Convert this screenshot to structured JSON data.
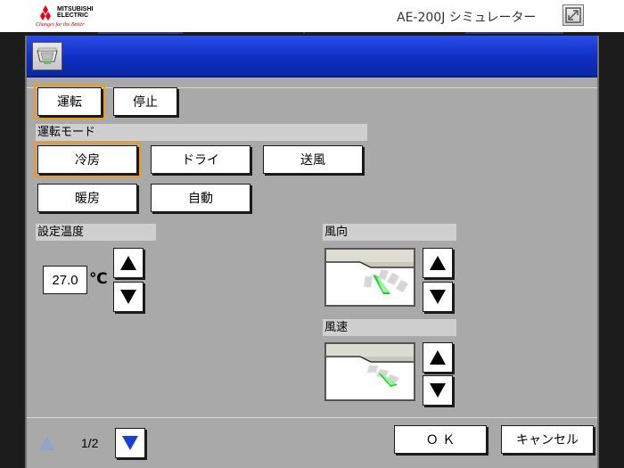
{
  "header": {
    "brand_name_line1": "MITSUBISHI",
    "brand_name_line2": "ELECTRIC",
    "tagline": "Changes for the Better",
    "app_title": "AE-200J シミュレーター",
    "brand_color": "#e60012"
  },
  "panel": {
    "title_bar_color": "#1434d6",
    "background": "#a9a9a9",
    "icons": {
      "unit": "ceiling-cassette-icon",
      "resize": "resize-icon"
    }
  },
  "power": {
    "on_label": "運転",
    "off_label": "停止",
    "selected": "on"
  },
  "mode": {
    "section_label": "運転モード",
    "options": [
      "冷房",
      "ドライ",
      "送風",
      "暖房",
      "自動"
    ],
    "selected": "冷房"
  },
  "temperature": {
    "section_label": "設定温度",
    "value": "27.0",
    "unit": "℃"
  },
  "airflow_direction": {
    "section_label": "風向"
  },
  "fan_speed": {
    "section_label": "風速"
  },
  "paging": {
    "label": "1/2"
  },
  "footer": {
    "ok_label": "Ｏ Ｋ",
    "cancel_label": "キャンセル"
  },
  "accent": {
    "selected_outline": "#f29a1e",
    "nav_arrow_active": "#1a3fd8",
    "nav_arrow_disabled": "#8fa6c8"
  }
}
